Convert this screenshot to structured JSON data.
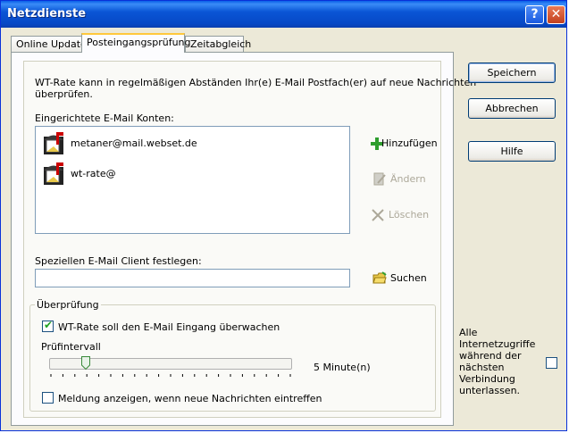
{
  "window": {
    "title": "Netzdienste",
    "help_glyph": "?",
    "close_glyph": "✕"
  },
  "tabs": [
    {
      "label": "Online Update"
    },
    {
      "label": "Posteingangsprüfung"
    },
    {
      "label": "Zeitabgleich"
    }
  ],
  "panel": {
    "intro_line1": "WT-Rate kann in regelmäßigen Abständen Ihr(e) E-Mail Postfach(er) auf neue Nachrichten",
    "intro_line2": "überprüfen.",
    "accounts_label": "Eingerichtete E-Mail Konten:",
    "accounts": [
      {
        "address": "metaner@mail.webset.de"
      },
      {
        "address": "wt-rate@"
      }
    ],
    "actions": {
      "add": "Hinzufügen",
      "edit": "Ändern",
      "delete": "Löschen"
    },
    "client_label": "Speziellen E-Mail Client festlegen:",
    "client_value": "",
    "search_label": "Suchen",
    "check_group": {
      "title": "Überprüfung",
      "monitor_label": "WT-Rate soll den E-Mail Eingang überwachen",
      "monitor_checked": true,
      "interval_label": "Prüfintervall",
      "interval_value_text": "5 Minute(n)",
      "interval_slider_fraction": 0.15,
      "notify_label": "Meldung anzeigen, wenn neue Nachrichten eintreffen",
      "notify_checked": false
    }
  },
  "buttons": {
    "save": "Speichern",
    "cancel": "Abbrechen",
    "help": "Hilfe"
  },
  "offline": {
    "text": "Alle Internetzugriffe während der nächsten Verbindung unterlassen.",
    "checked": false
  },
  "colors": {
    "titlebar": "#0a56d6",
    "tab_highlight": "#ffc83c",
    "check_green": "#21a121"
  }
}
